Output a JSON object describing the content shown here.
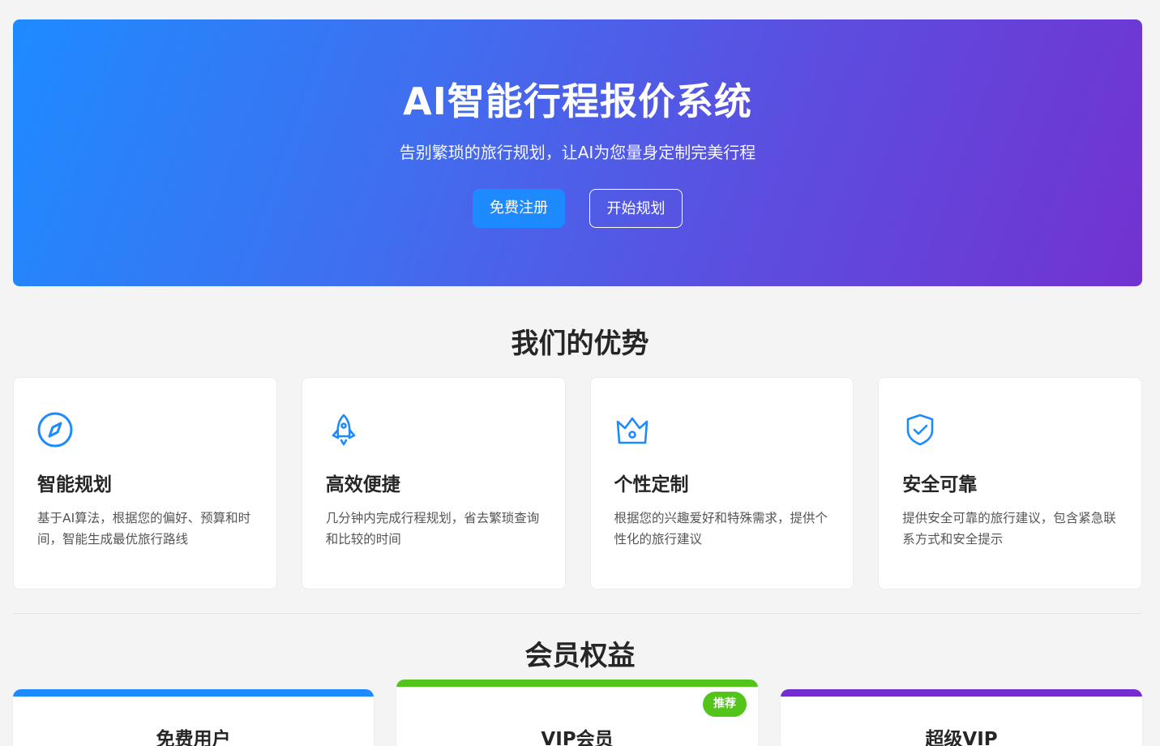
{
  "hero": {
    "title": "AI智能行程报价系统",
    "subtitle": "告别繁琐的旅行规划，让AI为您量身定制完美行程",
    "register_label": "免费注册",
    "start_label": "开始规划"
  },
  "advantages": {
    "title": "我们的优势",
    "items": [
      {
        "icon": "compass-icon",
        "title": "智能规划",
        "desc": "基于AI算法，根据您的偏好、预算和时间，智能生成最优旅行路线"
      },
      {
        "icon": "rocket-icon",
        "title": "高效便捷",
        "desc": "几分钟内完成行程规划，省去繁琐查询和比较的时间"
      },
      {
        "icon": "crown-icon",
        "title": "个性定制",
        "desc": "根据您的兴趣爱好和特殊需求，提供个性化的旅行建议"
      },
      {
        "icon": "shield-check-icon",
        "title": "安全可靠",
        "desc": "提供安全可靠的旅行建议，包含紧急联系方式和安全提示"
      }
    ]
  },
  "membership": {
    "title": "会员权益",
    "plans": [
      {
        "name": "免费用户",
        "accent": "#1d8bff"
      },
      {
        "name": "VIP会员",
        "accent": "#52c41a",
        "badge": "推荐"
      },
      {
        "name": "超级VIP",
        "accent": "#722ed1"
      }
    ]
  },
  "colors": {
    "primary": "#1d8bff",
    "icon": "#1d8bff",
    "hero_gradient_start": "#1e8bff",
    "hero_gradient_end": "#7232d0"
  }
}
